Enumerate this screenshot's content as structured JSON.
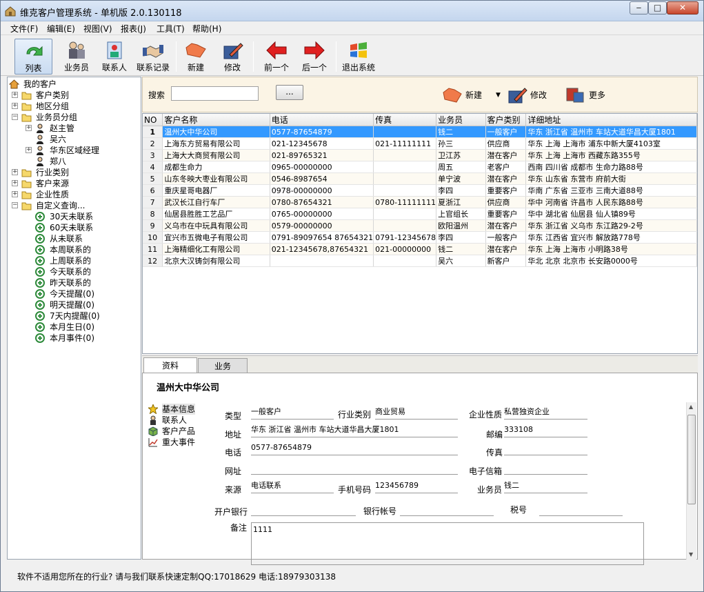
{
  "window": {
    "title": "维克客户管理系统 - 单机版 2.0.130118",
    "min": "‒",
    "max": "□",
    "close": "✕"
  },
  "menu": [
    "文件(F)",
    "编辑(E)",
    "视图(V)",
    "报表(J)",
    "工具(T)",
    "帮助(H)"
  ],
  "toolbar": {
    "list": "列表",
    "staff": "业务员",
    "contact": "联系人",
    "contact_log": "联系记录",
    "new": "新建",
    "edit": "修改",
    "prev": "前一个",
    "next": "后一个",
    "exit": "退出系统"
  },
  "tree": {
    "root": "我的客户",
    "customer_type": "客户类别",
    "region": "地区分组",
    "staff_group": "业务员分组",
    "staff": [
      "赵主管",
      "吴六",
      "华东区域经理",
      "郑八"
    ],
    "industry": "行业类别",
    "source": "客户来源",
    "nature": "企业性质",
    "custom": "自定义查询...",
    "queries": [
      "30天未联系",
      "60天未联系",
      "从未联系",
      "本周联系的",
      "上周联系的",
      "今天联系的",
      "昨天联系的",
      "今天提醒(0)",
      "明天提醒(0)",
      "7天内提醒(0)",
      "本月生日(0)",
      "本月事件(0)"
    ]
  },
  "search": {
    "label": "搜索",
    "value": "",
    "button": "...",
    "new": "新建",
    "edit": "修改",
    "more": "更多"
  },
  "grid": {
    "headers": [
      "NO",
      "客户名称",
      "电话",
      "传真",
      "业务员",
      "客户类别",
      "详细地址"
    ],
    "rows": [
      [
        "1",
        "温州大中华公司",
        "0577-87654879",
        "",
        "钱二",
        "一般客户",
        "华东 浙江省 温州市 车站大道华昌大厦1801"
      ],
      [
        "2",
        "上海东方贸易有限公司",
        "021-12345678",
        "021-11111111",
        "孙三",
        "供应商",
        "华东 上海 上海市 浦东中新大厦4103室"
      ],
      [
        "3",
        "上海大大商贸有限公司",
        "021-89765321",
        "",
        "卫江苏",
        "潜在客户",
        "华东 上海 上海市 西藏东路355号"
      ],
      [
        "4",
        "成都生命力",
        "0965-00000000",
        "",
        "周五",
        "老客户",
        "西南 四川省 成都市 生命力路88号"
      ],
      [
        "5",
        "山东冬映大枣业有限公司",
        "0546-8987654",
        "",
        "单宁波",
        "潜在客户",
        "华东 山东省 东营市 府前大街"
      ],
      [
        "6",
        "重庆星哥电器厂",
        "0978-00000000",
        "",
        "李四",
        "重要客户",
        "华南 广东省 三亚市 三南大道88号"
      ],
      [
        "7",
        "武汉长江自行车厂",
        "0780-87654321",
        "0780-11111111",
        "夏浙江",
        "供应商",
        "华中 河南省 许昌市 人民东路88号"
      ],
      [
        "8",
        "仙居县胜胜工艺品厂",
        "0765-00000000",
        "",
        "上官组长",
        "重要客户",
        "华中 湖北省 仙居县 仙人镇89号"
      ],
      [
        "9",
        "义乌市在中玩具有限公司",
        "0579-00000000",
        "",
        "欧阳温州",
        "潜在客户",
        "华东 浙江省 义乌市 东江路29-2号"
      ],
      [
        "10",
        "宜兴市五微电子有限公司",
        "0791-89097654 87654321",
        "0791-12345678",
        "李四",
        "一般客户",
        "华东 江西省 宜兴市 解放路778号"
      ],
      [
        "11",
        "上海精细化工有限公司",
        "021-12345678,87654321",
        "021-00000000",
        "钱二",
        "潜在客户",
        "华东 上海 上海市 小明路38号"
      ],
      [
        "12",
        "北京大汉铸剑有限公司",
        "",
        "",
        "吴六",
        "新客户",
        "华北 北京 北京市 长安路0000号"
      ]
    ]
  },
  "tabs": [
    "资料",
    "业务"
  ],
  "detail": {
    "name": "温州大中华公司",
    "nav": [
      "基本信息",
      "联系人",
      "客户产品",
      "重大事件"
    ],
    "labels": {
      "type": "类型",
      "industry": "行业类别",
      "nature": "企业性质",
      "address": "地址",
      "postcode": "邮编",
      "phone": "电话",
      "fax": "传真",
      "website": "网址",
      "email": "电子信箱",
      "source": "来源",
      "mobile": "手机号码",
      "staff": "业务员",
      "bank": "开户银行",
      "account": "银行帐号",
      "tax": "税号",
      "memo": "备注"
    },
    "values": {
      "type": "一般客户",
      "industry": "商业贸易",
      "nature": "私营独资企业",
      "address": "华东  浙江省  温州市  车站大道华昌大厦1801",
      "postcode": "333108",
      "phone": "0577-87654879",
      "fax": "",
      "website": "",
      "email": "",
      "source": "电话联系",
      "mobile": "123456789",
      "staff": "钱二",
      "bank": "",
      "account": "",
      "tax": "",
      "memo": "1111"
    }
  },
  "status": "软件不适用您所在的行业? 请与我们联系快速定制QQ:17018629 电话:18979303138",
  "colors": {
    "selection": "#3399ff",
    "search_bg": "#fbf4e5",
    "alt_row": "#fdfaf2"
  }
}
